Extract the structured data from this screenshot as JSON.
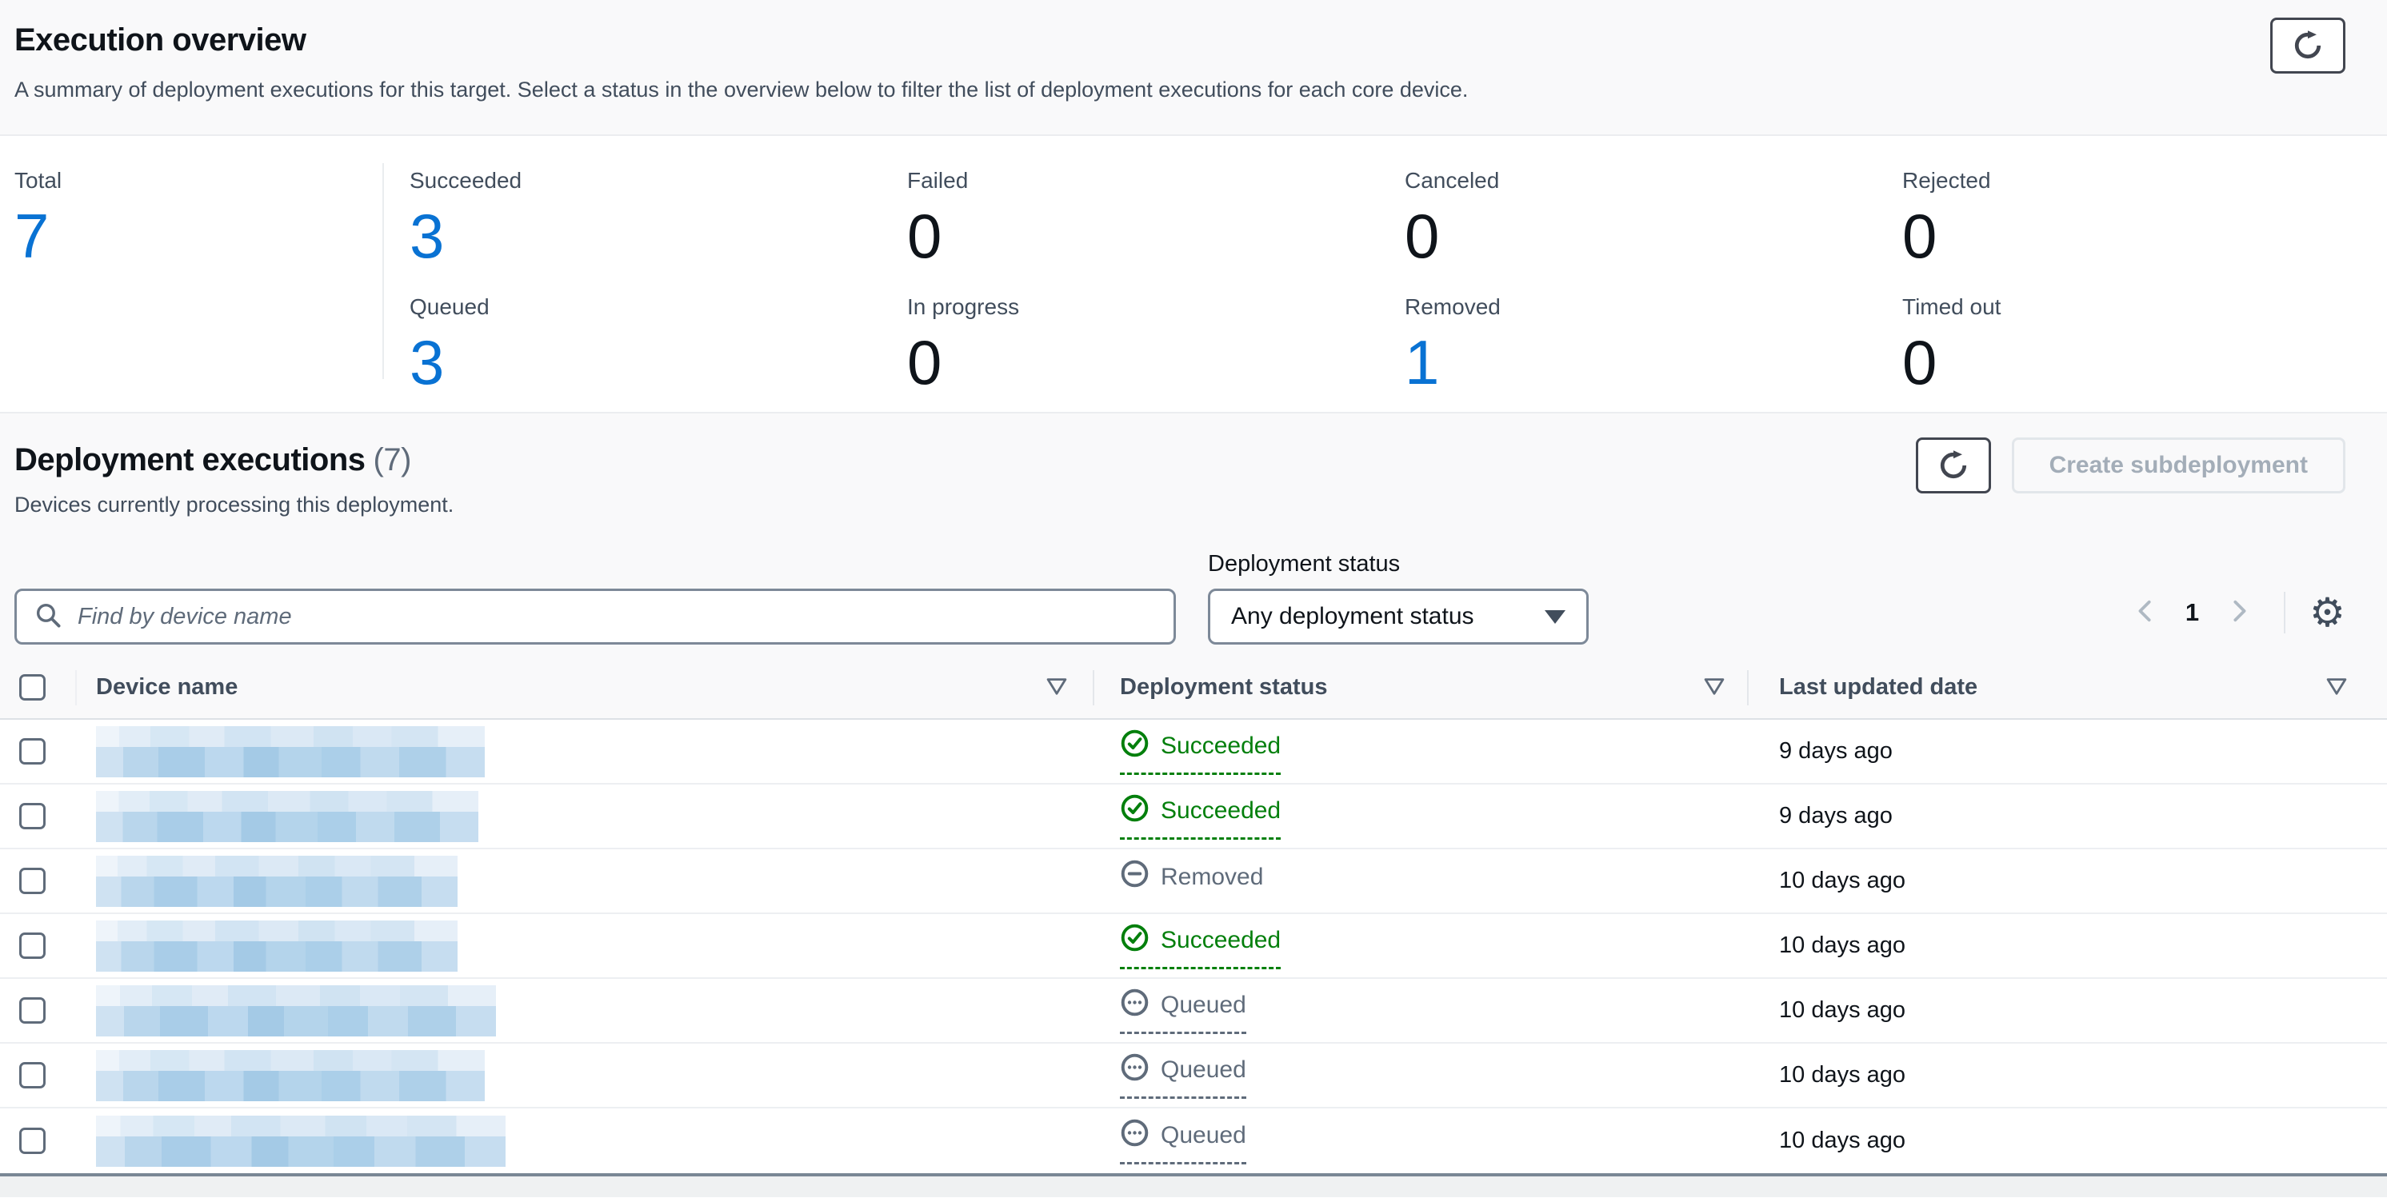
{
  "execution_overview": {
    "title": "Execution overview",
    "description": "A summary of deployment executions for this target. Select a status in the overview below to filter the list of deployment executions for each core device.",
    "refresh_button": "refresh",
    "stats": {
      "total": {
        "label": "Total",
        "value": "7",
        "highlight": true
      },
      "items": [
        {
          "label": "Succeeded",
          "value": "3",
          "highlight": true
        },
        {
          "label": "Failed",
          "value": "0",
          "highlight": false
        },
        {
          "label": "Canceled",
          "value": "0",
          "highlight": false
        },
        {
          "label": "Rejected",
          "value": "0",
          "highlight": false
        },
        {
          "label": "Queued",
          "value": "3",
          "highlight": true
        },
        {
          "label": "In progress",
          "value": "0",
          "highlight": false
        },
        {
          "label": "Removed",
          "value": "1",
          "highlight": true
        },
        {
          "label": "Timed out",
          "value": "0",
          "highlight": false
        }
      ]
    }
  },
  "deployment_executions": {
    "title": "Deployment executions",
    "count": "(7)",
    "description": "Devices currently processing this deployment.",
    "refresh_button": "refresh",
    "create_button_label": "Create subdeployment",
    "create_button_disabled": true,
    "search_placeholder": "Find by device name",
    "status_filter_label": "Deployment status",
    "status_filter_value": "Any deployment status",
    "pagination": {
      "current_page": "1"
    },
    "table": {
      "columns": [
        "Device name",
        "Deployment status",
        "Last updated date"
      ],
      "device_names_redacted": true,
      "rows": [
        {
          "status": "Succeeded",
          "status_type": "success",
          "status_popover": true,
          "last_updated": "9 days ago"
        },
        {
          "status": "Succeeded",
          "status_type": "success",
          "status_popover": true,
          "last_updated": "9 days ago"
        },
        {
          "status": "Removed",
          "status_type": "removed",
          "status_popover": false,
          "last_updated": "10 days ago"
        },
        {
          "status": "Succeeded",
          "status_type": "success",
          "status_popover": true,
          "last_updated": "10 days ago"
        },
        {
          "status": "Queued",
          "status_type": "queued",
          "status_popover": true,
          "last_updated": "10 days ago"
        },
        {
          "status": "Queued",
          "status_type": "queued",
          "status_popover": true,
          "last_updated": "10 days ago"
        },
        {
          "status": "Queued",
          "status_type": "queued",
          "status_popover": true,
          "last_updated": "10 days ago"
        }
      ]
    }
  },
  "icons": {
    "settings_glyph": "⚙"
  },
  "colors": {
    "accent_blue": "#0972d3",
    "success_green": "#037f0c",
    "muted_gray": "#5f6b7a",
    "heading": "#0f141a",
    "secondary_text": "#414d5c",
    "section_band_bg": "#f9f9fa",
    "table_bottom_border": "#7a8795",
    "redaction_blue": "#a9cde8"
  }
}
